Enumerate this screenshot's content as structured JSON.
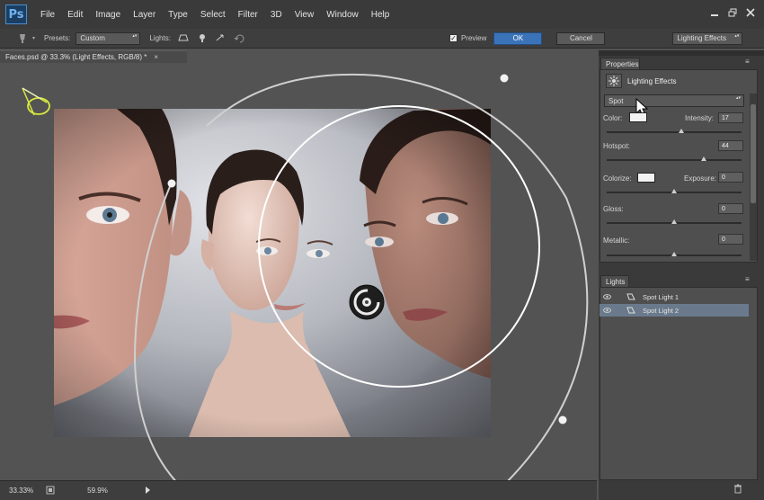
{
  "app": {
    "logo": "Ps"
  },
  "menu": [
    "File",
    "Edit",
    "Image",
    "Layer",
    "Type",
    "Select",
    "Filter",
    "3D",
    "View",
    "Window",
    "Help"
  ],
  "window_controls": [
    "minimize-icon",
    "restore-icon",
    "close-icon"
  ],
  "options_bar": {
    "presets_label": "Presets:",
    "presets_value": "Custom",
    "lights_label": "Lights:",
    "preview_label": "Preview",
    "preview_checked": true,
    "ok_label": "OK",
    "cancel_label": "Cancel",
    "workspace_value": "Lighting Effects"
  },
  "document_tab": {
    "title": "Faces.psd @ 33.3% (Light Effects, RGB/8) *",
    "close": "×"
  },
  "status_bar": {
    "zoom": "33.33%",
    "info": "59.9%"
  },
  "properties_panel": {
    "tab_label": "Properties",
    "title": "Lighting Effects",
    "light_type": "Spot",
    "color_label": "Color:",
    "intensity_label": "Intensity:",
    "intensity_value": "17",
    "intensity_level": 0.55,
    "hotspot_label": "Hotspot:",
    "hotspot_value": "44",
    "hotspot_level": 0.72,
    "colorize_label": "Colorize:",
    "exposure_label": "Exposure:",
    "exposure_value": "0",
    "exposure_level": 0.5,
    "gloss_label": "Gloss:",
    "gloss_value": "0",
    "gloss_level": 0.5,
    "metallic_label": "Metallic:",
    "metallic_value": "0",
    "metallic_level": 0.5,
    "colors": {
      "light_color": "#f2f2f2",
      "colorize_color": "#f2f2f2"
    }
  },
  "lights_panel": {
    "tab_label": "Lights",
    "items": [
      {
        "label": "Spot Light 1",
        "selected": false
      },
      {
        "label": "Spot Light 2",
        "selected": true
      }
    ]
  }
}
